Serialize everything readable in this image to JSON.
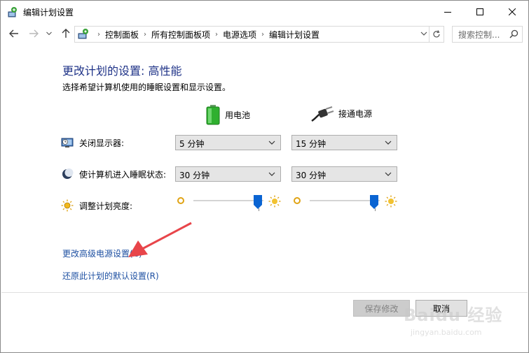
{
  "window": {
    "title": "编辑计划设置"
  },
  "nav": {
    "breadcrumbs": [
      "控制面板",
      "所有控制面板项",
      "电源选项",
      "编辑计划设置"
    ],
    "search_placeholder": "搜索控制..."
  },
  "content": {
    "heading": "更改计划的设置: 高性能",
    "subheading": "选择希望计算机使用的睡眠设置和显示设置。",
    "columns": {
      "battery": "用电池",
      "plugged": "接通电源"
    },
    "rows": {
      "display_label": "关闭显示器:",
      "display_battery": "5 分钟",
      "display_plugged": "15 分钟",
      "sleep_label": "使计算机进入睡眠状态:",
      "sleep_battery": "30 分钟",
      "sleep_plugged": "30 分钟",
      "brightness_label": "调整计划亮度:",
      "brightness_battery_level": 1.0,
      "brightness_plugged_level": 1.0
    },
    "links": {
      "advanced": "更改高级电源设置(C)",
      "restore": "还原此计划的默认设置(R)"
    },
    "buttons": {
      "save": "保存修改",
      "cancel": "取消"
    }
  },
  "watermark": {
    "main": "Baidu 经验",
    "sub": "jingyan.baidu.com"
  },
  "colors": {
    "heading": "#1e3287",
    "link": "#1e50a2",
    "slider_thumb": "#0a64d2",
    "annotation_arrow": "#e8454a"
  }
}
